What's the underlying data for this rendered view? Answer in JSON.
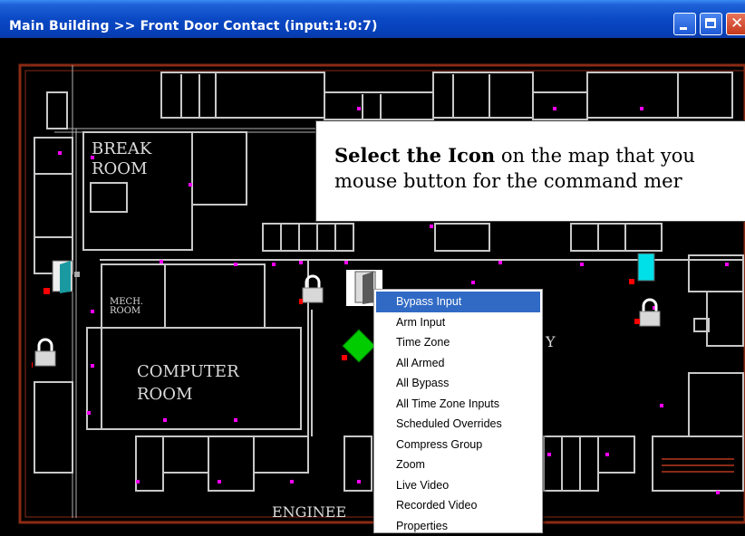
{
  "window": {
    "title": "Main Building  >>  Front Door Contact (input:1:0:7)",
    "minimize_icon": "minimize-icon",
    "maximize_icon": "maximize-icon",
    "close_icon": "close-icon"
  },
  "map": {
    "room_labels": {
      "break_room_line1": "BREAK",
      "break_room_line2": "ROOM",
      "mech_room_line1": "MECH.",
      "mech_room_line2": "ROOM",
      "computer_room_line1": "COMPUTER",
      "computer_room_line2": "ROOM",
      "engineering": "ENGINEE",
      "partial_y": "Y"
    }
  },
  "callout": {
    "bold": "Select the Icon",
    "rest_line1": " on the map that you",
    "line2": "mouse button for the command mer"
  },
  "context_menu": {
    "items": [
      "Bypass Input",
      "Arm Input",
      "Time Zone",
      "All Armed",
      "All Bypass",
      "All Time Zone Inputs",
      "Scheduled Overrides",
      "Compress Group",
      "Zoom",
      "Live Video",
      "Recorded Video",
      "Properties"
    ],
    "selected_index": 0
  },
  "colors": {
    "titlebar": "#0a48c4",
    "walls": "#c8c8c8",
    "exterior_wall": "#8a2a14",
    "marker_magenta": "#ff00ff",
    "alarm_red": "#ff0000",
    "door_cyan": "#00e0e8",
    "selection": "#316ac5",
    "status_green": "#00cc00"
  }
}
